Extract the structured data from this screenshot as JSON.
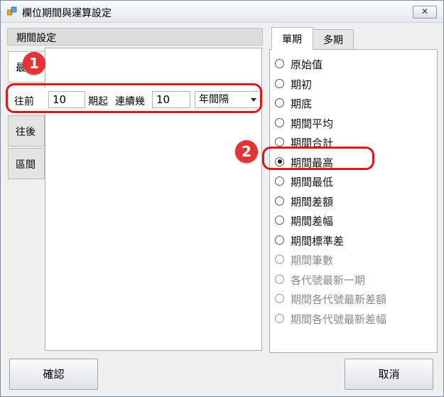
{
  "window": {
    "title": "欄位期間與運算設定",
    "close_symbol": "✕"
  },
  "period_panel": {
    "header": "期間設定",
    "tabs": [
      "最",
      "往前",
      "往後",
      "區間"
    ],
    "row": {
      "prefix_label": "往前",
      "start_value": "10",
      "start_label": "期起",
      "consecutive_label": "連續幾",
      "consecutive_value": "10",
      "interval_selected": "年間隔"
    }
  },
  "calc_panel": {
    "tabs": [
      "單期",
      "多期"
    ],
    "active_tab": "單期",
    "options": [
      {
        "label": "原始值",
        "enabled": true,
        "checked": false
      },
      {
        "label": "期初",
        "enabled": true,
        "checked": false
      },
      {
        "label": "期底",
        "enabled": true,
        "checked": false
      },
      {
        "label": "期間平均",
        "enabled": true,
        "checked": false
      },
      {
        "label": "期間合計",
        "enabled": true,
        "checked": false
      },
      {
        "label": "期間最高",
        "enabled": true,
        "checked": true
      },
      {
        "label": "期間最低",
        "enabled": true,
        "checked": false
      },
      {
        "label": "期間差額",
        "enabled": true,
        "checked": false
      },
      {
        "label": "期間差幅",
        "enabled": true,
        "checked": false
      },
      {
        "label": "期間標準差",
        "enabled": true,
        "checked": false
      },
      {
        "label": "期間筆數",
        "enabled": false,
        "checked": false
      },
      {
        "label": "各代號最新一期",
        "enabled": false,
        "checked": false
      },
      {
        "label": "期間各代號最新差額",
        "enabled": false,
        "checked": false
      },
      {
        "label": "期間各代號最新差幅",
        "enabled": false,
        "checked": false
      }
    ]
  },
  "buttons": {
    "confirm": "確認",
    "cancel": "取消"
  },
  "callouts": [
    {
      "number": "1",
      "color": "#e23434"
    },
    {
      "number": "2",
      "color": "#e23434"
    }
  ]
}
